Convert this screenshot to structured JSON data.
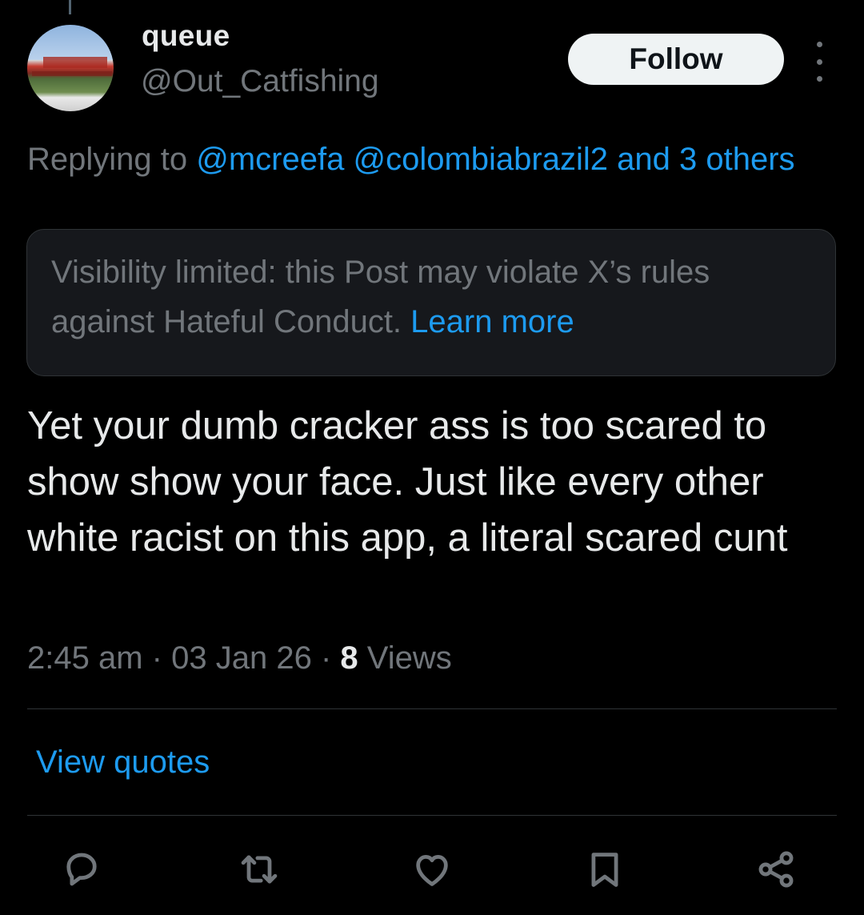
{
  "post": {
    "author_name": "queue",
    "author_handle": "@Out_Catfishing",
    "follow_label": "Follow",
    "replying_prefix": "Replying to",
    "mention_1": "@mcreefa",
    "mention_2": "@colombiabrazil2",
    "mention_others": "and 3 others",
    "notice_text": "Visibility limited: this Post may violate X’s rules against Hateful Conduct.",
    "notice_link": "Learn more",
    "text": "Yet your dumb cracker ass is too scared to show show your face. Just like every other white racist on this app, a literal scared cunt",
    "time": "2:45 am",
    "date": "03 Jan 26",
    "views_count": "8",
    "views_label": "Views",
    "separator": "·",
    "view_quotes": "View quotes"
  },
  "icons": {
    "reply": "reply-icon",
    "repost": "repost-icon",
    "like": "like-icon",
    "bookmark": "bookmark-icon",
    "share": "share-icon",
    "more": "more-vertical-icon"
  },
  "colors": {
    "background": "#000000",
    "text": "#e7e9ea",
    "secondary": "#71767b",
    "accent": "#1d9bf0",
    "notice_bg": "#16181c",
    "button_bg": "#eff3f4"
  }
}
